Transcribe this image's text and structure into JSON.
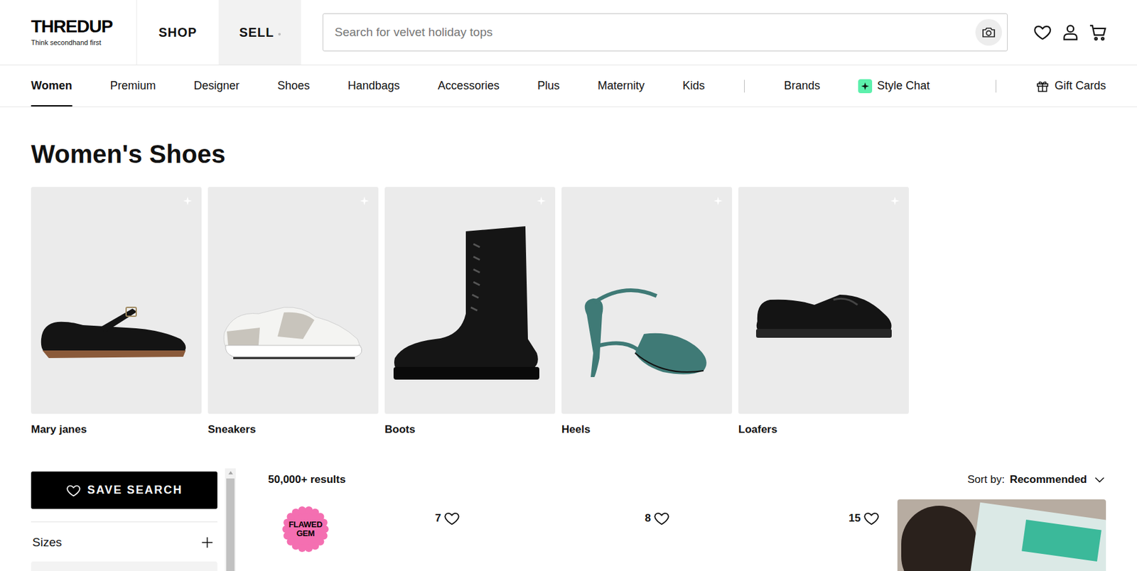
{
  "header": {
    "logo": "THREDUP",
    "tagline": "Think secondhand first",
    "tabs": [
      {
        "label": "SHOP",
        "selected": true
      },
      {
        "label": "SELL",
        "selected": false
      }
    ],
    "search": {
      "placeholder": "Search for velvet holiday tops"
    }
  },
  "nav": {
    "items": [
      {
        "label": "Women",
        "selected": true
      },
      {
        "label": "Premium",
        "selected": false
      },
      {
        "label": "Designer",
        "selected": false
      },
      {
        "label": "Shoes",
        "selected": false
      },
      {
        "label": "Handbags",
        "selected": false
      },
      {
        "label": "Accessories",
        "selected": false
      },
      {
        "label": "Plus",
        "selected": false
      },
      {
        "label": "Maternity",
        "selected": false
      },
      {
        "label": "Kids",
        "selected": false
      }
    ],
    "extra": [
      {
        "label": "Brands"
      },
      {
        "label": "Style Chat"
      }
    ],
    "gift_cards": "Gift Cards"
  },
  "page": {
    "title": "Women's Shoes"
  },
  "categories": [
    {
      "label": "Mary janes",
      "kind": "mary-jane"
    },
    {
      "label": "Sneakers",
      "kind": "sneaker"
    },
    {
      "label": "Boots",
      "kind": "boot"
    },
    {
      "label": "Heels",
      "kind": "heel"
    },
    {
      "label": "Loafers",
      "kind": "loafer"
    }
  ],
  "sidebar": {
    "save_search": "SAVE SEARCH",
    "filters": [
      {
        "label": "Sizes",
        "expanded": false
      }
    ]
  },
  "results": {
    "count": "50,000+ results",
    "sort_label": "Sort by:",
    "sort_value": "Recommended"
  },
  "products": [
    {
      "kind": "item",
      "badge": "FLAWED GEM",
      "likes": "7"
    },
    {
      "kind": "item",
      "likes": "8"
    },
    {
      "kind": "item",
      "likes": "15"
    },
    {
      "kind": "promo"
    }
  ]
}
